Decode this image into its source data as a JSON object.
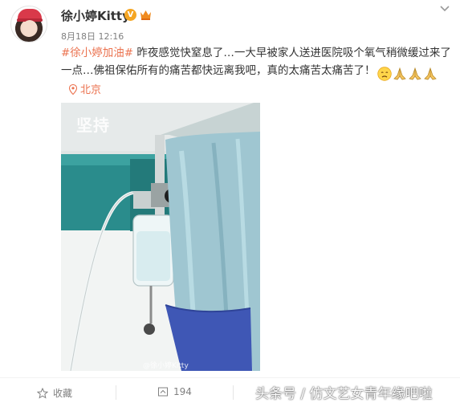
{
  "post": {
    "username": "徐小婷Kitty",
    "verified_badge": "V",
    "timestamp": "8月18日 12:16",
    "hashtag": "#徐小婷加油#",
    "text": " 昨夜感觉快窒息了…一大早被家人送进医院吸个氧气稍微缓过来了一点…佛祖保佑所有的痛苦都快远离我吧，真的太痛苦太痛苦了！",
    "emojis": [
      "sad-face-emoji",
      "praying-hands-emoji",
      "praying-hands-emoji",
      "praying-hands-emoji"
    ],
    "location": "北京",
    "photo": {
      "watermark_top": "坚持",
      "watermark_bottom": "@徐小婷Kitty"
    }
  },
  "footer": {
    "favorite_label": "收藏",
    "repost_count": "194",
    "watermark": "头条号 / 仿文艺女青年缘吧啦"
  },
  "colors": {
    "accent": "#eb7350",
    "badge": "#f5a623",
    "text": "#333333",
    "meta": "#808080"
  }
}
